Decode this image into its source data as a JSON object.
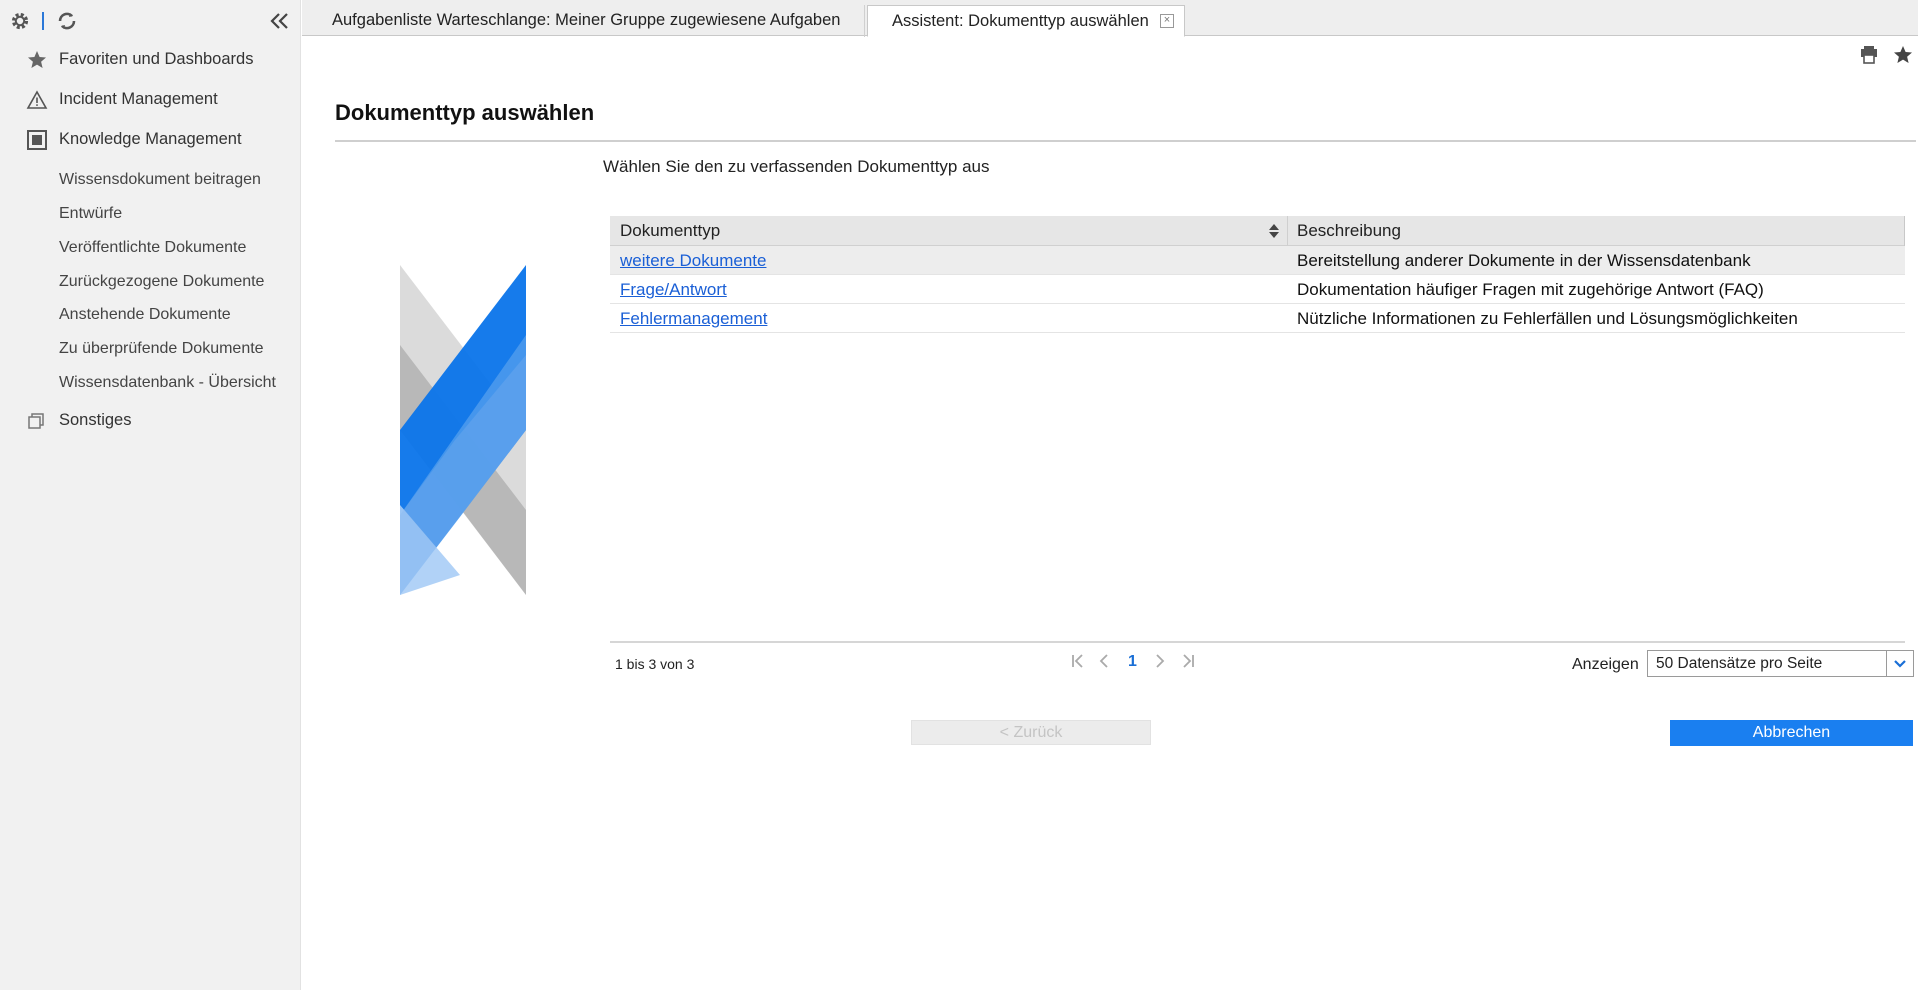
{
  "sidebar": {
    "top_icons": [
      "gear-icon",
      "refresh-icon",
      "collapse-double-chevron-icon"
    ],
    "main_items": [
      {
        "label": "Favoriten und Dashboards",
        "icon": "star-icon"
      },
      {
        "label": "Incident Management",
        "icon": "warning-triangle-icon"
      },
      {
        "label": "Knowledge Management",
        "icon": "knowledge-box-icon"
      }
    ],
    "sub_items": [
      {
        "label": "Wissensdokument beitragen"
      },
      {
        "label": "Entwürfe"
      },
      {
        "label": "Veröffentlichte Dokumente"
      },
      {
        "label": "Zurückgezogene Dokumente"
      },
      {
        "label": "Anstehende Dokumente"
      },
      {
        "label": "Zu überprüfende Dokumente"
      },
      {
        "label": "Wissensdatenbank - Übersicht"
      }
    ],
    "other_item": {
      "label": "Sonstiges",
      "icon": "stacked-pages-icon"
    }
  },
  "tabs": [
    {
      "label": "Aufgabenliste Warteschlange: Meiner Gruppe zugewiesene Aufgaben",
      "active": false
    },
    {
      "label": "Assistent: Dokumenttyp auswählen",
      "active": true
    }
  ],
  "top_right_icons": [
    "print-icon",
    "favorite-star-icon"
  ],
  "page": {
    "title": "Dokumenttyp auswählen",
    "subtitle": "Wählen Sie den zu verfassenden Dokumenttyp aus"
  },
  "table": {
    "columns": [
      "Dokumenttyp",
      "Beschreibung"
    ],
    "rows": [
      {
        "type": "weitere Dokumente",
        "description": "Bereitstellung anderer Dokumente in der Wissensdatenbank"
      },
      {
        "type": "Frage/Antwort",
        "description": "Dokumentation häufiger Fragen mit zugehörige Antwort (FAQ)"
      },
      {
        "type": "Fehlermanagement",
        "description": "Nützliche Informationen zu Fehlerfällen und Lösungsmöglichkeiten"
      }
    ]
  },
  "pager": {
    "info": "1 bis 3 von 3",
    "current_page": "1",
    "show_label": "Anzeigen",
    "page_size": "50 Datensätze pro Seite"
  },
  "buttons": {
    "back": "< Zurück",
    "cancel": "Abbrechen"
  },
  "colors": {
    "accent": "#1a7ff0",
    "link": "#1a5fd6",
    "sidebar_bg": "#f1f1f1"
  }
}
